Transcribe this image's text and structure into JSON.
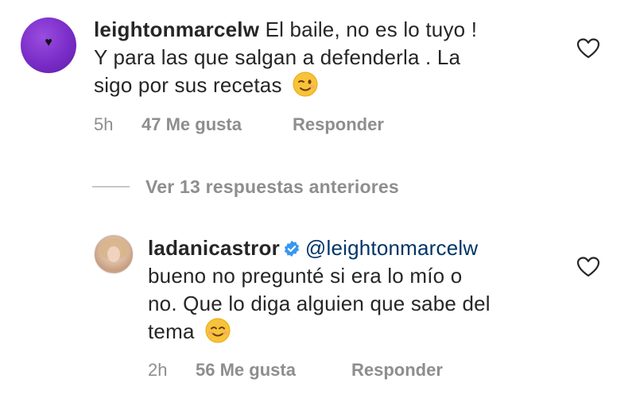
{
  "comments": [
    {
      "username": "leightonmarcelw",
      "text_line1": " El baile, no es lo tuyo !",
      "text_line2": "Y para las que salgan a defenderla . La",
      "text_line3": "sigo por sus recetas",
      "emoji_icon": "winking-face-emoji",
      "time": "5h",
      "likes": "47 Me gusta",
      "reply": "Responder"
    },
    {
      "username": "ladanicastror",
      "mention": "@leightonmarcelw",
      "text_line1": "bueno no pregunté si era lo mío o",
      "text_line2": "no. Que lo diga alguien que sabe del",
      "text_line3": "tema",
      "emoji_icon": "smiling-face-emoji",
      "verified_icon": "verified-badge-icon",
      "time": "2h",
      "likes": "56 Me gusta",
      "reply": "Responder"
    }
  ],
  "view_previous_replies": "Ver 13 respuestas anteriores",
  "colors": {
    "text": "#262626",
    "meta": "#8e8e8e",
    "mention": "#003569",
    "verified": "#3897f0",
    "avatar1": "#7a2cc7"
  }
}
